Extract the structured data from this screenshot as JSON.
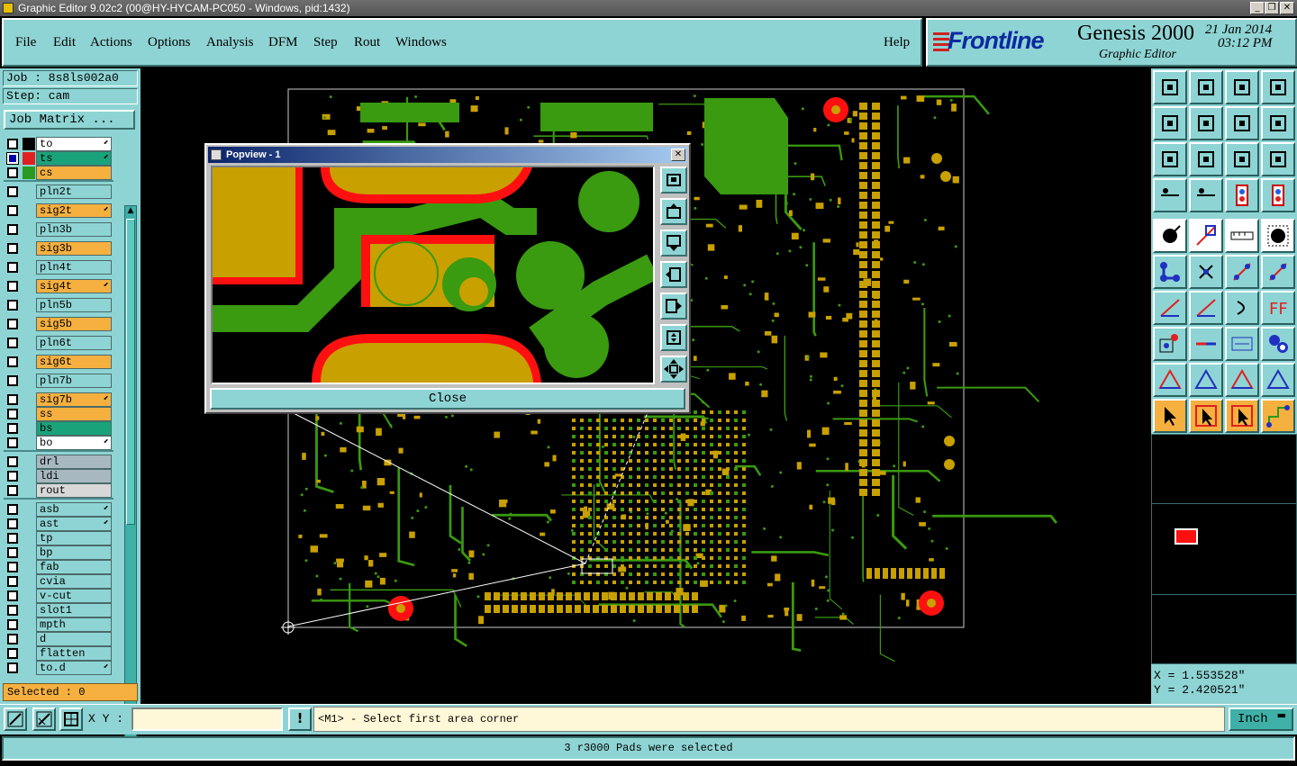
{
  "window": {
    "title": "Graphic Editor 9.02c2 (00@HY-HYCAM-PC050 - Windows, pid:1432)"
  },
  "menu": {
    "items": [
      "File",
      "Edit",
      "Actions",
      "Options",
      "Analysis",
      "DFM",
      "Step",
      "Rout",
      "Windows"
    ],
    "help": "Help"
  },
  "brand": {
    "logo": "Frontline",
    "product": "Genesis 2000",
    "subtitle": "Graphic Editor",
    "date": "21 Jan 2014",
    "time": "03:12 PM"
  },
  "job": {
    "job_line": "Job : 8s8ls002a0",
    "step_line": "Step: cam",
    "matrix_button": "Job Matrix ..."
  },
  "layers": [
    {
      "name": "to",
      "color": "#ffffff",
      "swatch": "#000000",
      "arrow": true,
      "selected": false
    },
    {
      "name": "ts",
      "color": "#1aa37a",
      "swatch": "#e02020",
      "arrow": true,
      "selected": true
    },
    {
      "name": "cs",
      "color": "#f5b040",
      "swatch": "#2a9a20",
      "arrow": false,
      "selected": false
    },
    {
      "name": "pln2t",
      "color": "#8fd4d4",
      "swatch": "",
      "arrow": false,
      "selected": false
    },
    {
      "name": "sig2t",
      "color": "#f5b040",
      "swatch": "",
      "arrow": true,
      "selected": false
    },
    {
      "name": "pln3b",
      "color": "#8fd4d4",
      "swatch": "",
      "arrow": false,
      "selected": false
    },
    {
      "name": "sig3b",
      "color": "#f5b040",
      "swatch": "",
      "arrow": false,
      "selected": false
    },
    {
      "name": "pln4t",
      "color": "#8fd4d4",
      "swatch": "",
      "arrow": false,
      "selected": false
    },
    {
      "name": "sig4t",
      "color": "#f5b040",
      "swatch": "",
      "arrow": true,
      "selected": false
    },
    {
      "name": "pln5b",
      "color": "#8fd4d4",
      "swatch": "",
      "arrow": false,
      "selected": false
    },
    {
      "name": "sig5b",
      "color": "#f5b040",
      "swatch": "",
      "arrow": false,
      "selected": false
    },
    {
      "name": "pln6t",
      "color": "#8fd4d4",
      "swatch": "",
      "arrow": false,
      "selected": false
    },
    {
      "name": "sig6t",
      "color": "#f5b040",
      "swatch": "",
      "arrow": false,
      "selected": false
    },
    {
      "name": "pln7b",
      "color": "#8fd4d4",
      "swatch": "",
      "arrow": false,
      "selected": false
    },
    {
      "name": "sig7b",
      "color": "#f5b040",
      "swatch": "",
      "arrow": true,
      "selected": false
    },
    {
      "name": "ss",
      "color": "#f5b040",
      "swatch": "",
      "arrow": false,
      "selected": false
    },
    {
      "name": "bs",
      "color": "#1aa37a",
      "swatch": "",
      "arrow": false,
      "selected": false
    },
    {
      "name": "bo",
      "color": "#ffffff",
      "swatch": "",
      "arrow": true,
      "selected": false
    },
    {
      "name": "drl",
      "color": "#a8b8c0",
      "swatch": "",
      "arrow": false,
      "selected": false
    },
    {
      "name": "ldi",
      "color": "#a8b8c0",
      "swatch": "",
      "arrow": false,
      "selected": false
    },
    {
      "name": "rout",
      "color": "#d8d8d8",
      "swatch": "",
      "arrow": false,
      "selected": false
    },
    {
      "name": "asb",
      "color": "#8fd4d4",
      "swatch": "",
      "arrow": true,
      "selected": false
    },
    {
      "name": "ast",
      "color": "#8fd4d4",
      "swatch": "",
      "arrow": true,
      "selected": false
    },
    {
      "name": "tp",
      "color": "#8fd4d4",
      "swatch": "",
      "arrow": false,
      "selected": false
    },
    {
      "name": "bp",
      "color": "#8fd4d4",
      "swatch": "",
      "arrow": false,
      "selected": false
    },
    {
      "name": "fab",
      "color": "#8fd4d4",
      "swatch": "",
      "arrow": false,
      "selected": false
    },
    {
      "name": "cvia",
      "color": "#8fd4d4",
      "swatch": "",
      "arrow": false,
      "selected": false
    },
    {
      "name": "v-cut",
      "color": "#8fd4d4",
      "swatch": "",
      "arrow": false,
      "selected": false
    },
    {
      "name": "slot1",
      "color": "#8fd4d4",
      "swatch": "",
      "arrow": false,
      "selected": false
    },
    {
      "name": "mpth",
      "color": "#8fd4d4",
      "swatch": "",
      "arrow": false,
      "selected": false
    },
    {
      "name": "d",
      "color": "#8fd4d4",
      "swatch": "",
      "arrow": false,
      "selected": false
    },
    {
      "name": "flatten",
      "color": "#8fd4d4",
      "swatch": "",
      "arrow": false,
      "selected": false
    },
    {
      "name": "to.d",
      "color": "#8fd4d4",
      "swatch": "",
      "arrow": true,
      "selected": false
    }
  ],
  "selected_count": "Selected : 0",
  "popview": {
    "title": "Popview - 1",
    "close_label": "Close"
  },
  "coords": {
    "x": "X = 1.553528\"",
    "y": "Y = 2.420521\""
  },
  "bottom": {
    "xy_label": "X Y :",
    "xy_value": "",
    "prompt": "<M1> - Select first area corner",
    "units": "Inch"
  },
  "status": "3 r3000 Pads were selected",
  "colors": {
    "panel": "#8fd4d4",
    "pad_orange": "#c8a000",
    "trace_green": "#3a9a10",
    "pad_red": "#ff1010",
    "selected_yellow": "#f5b040"
  }
}
